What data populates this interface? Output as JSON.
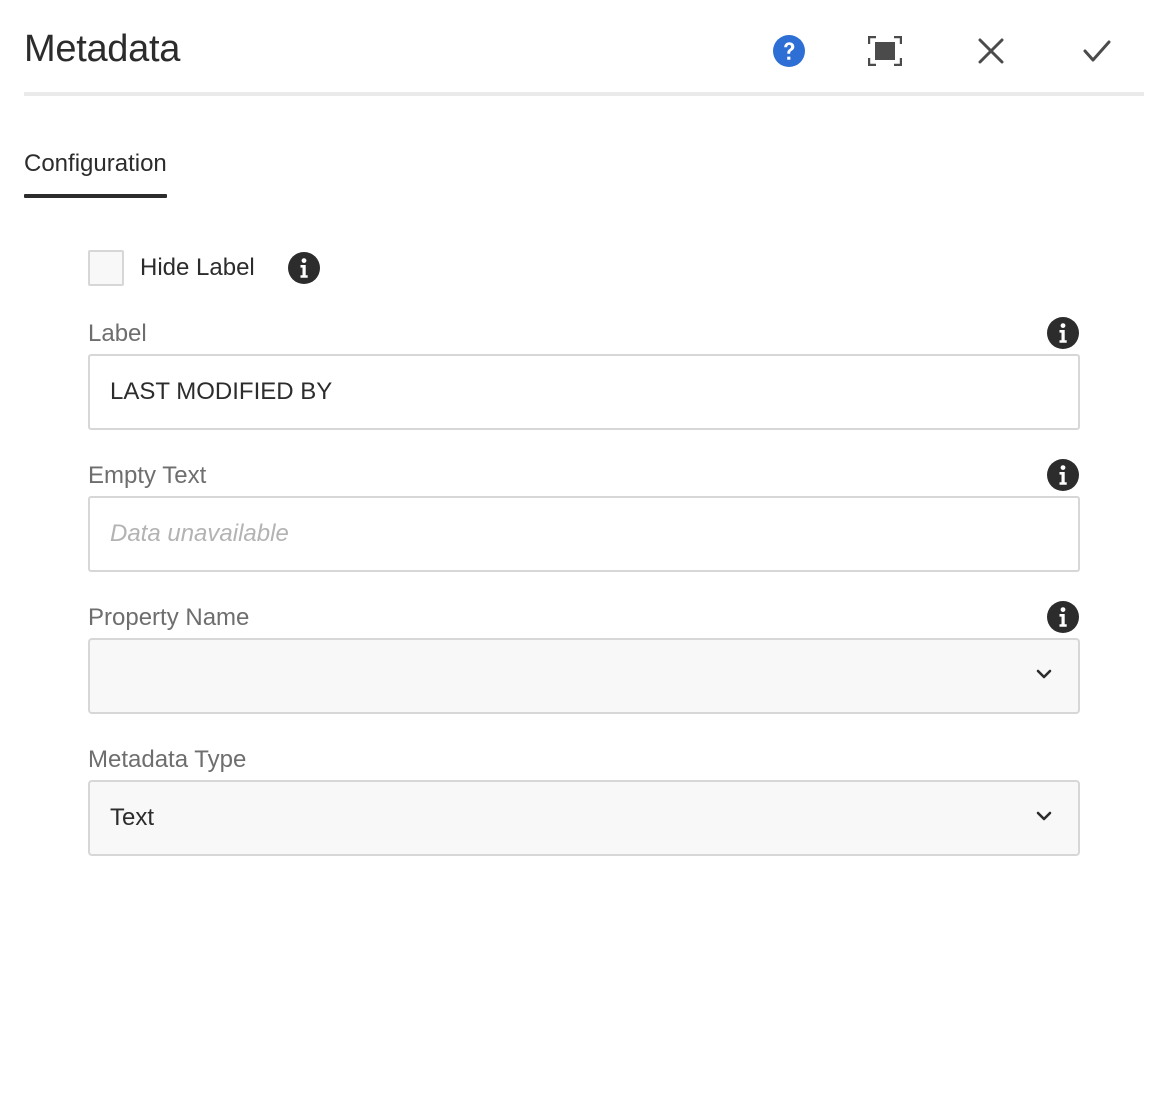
{
  "dialog": {
    "title": "Metadata",
    "accent_color": "#2d6fd5"
  },
  "tabs": [
    {
      "label": "Configuration",
      "selected": true
    }
  ],
  "form": {
    "hide_label": {
      "label": "Hide Label",
      "checked": false
    },
    "label_field": {
      "label": "Label",
      "value": "LAST MODIFIED BY",
      "placeholder": ""
    },
    "empty_text_field": {
      "label": "Empty Text",
      "value": "",
      "placeholder": "Data unavailable"
    },
    "property_name_field": {
      "label": "Property Name",
      "selected": ""
    },
    "metadata_type_field": {
      "label": "Metadata Type",
      "selected": "Text"
    }
  },
  "icons": {
    "help": "help-icon",
    "fullscreen": "fullscreen-icon",
    "close": "close-icon",
    "done": "checkmark-icon",
    "info": "info-icon",
    "dropdown": "chevron-down-icon"
  }
}
